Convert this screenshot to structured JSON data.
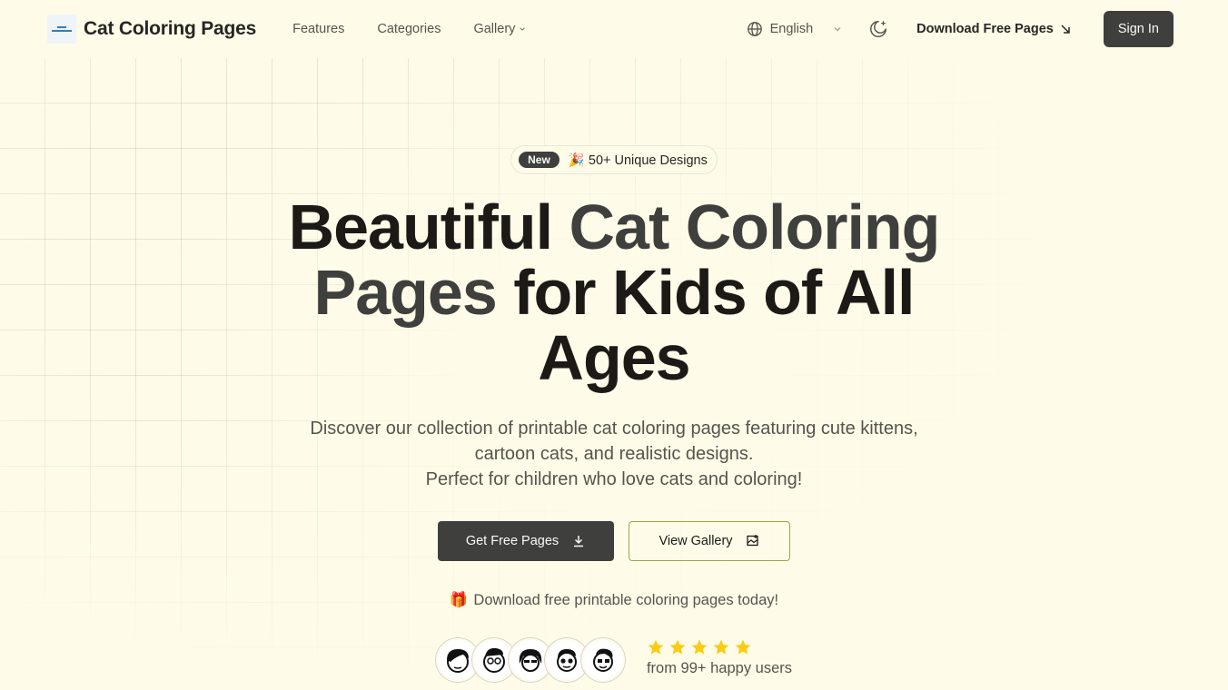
{
  "brand": {
    "name": "Cat Coloring Pages",
    "logo_icon": "brand-logo-icon"
  },
  "nav": {
    "items": [
      {
        "label": "Features"
      },
      {
        "label": "Categories"
      },
      {
        "label": "Gallery",
        "has_dropdown": true
      }
    ]
  },
  "header": {
    "language": "English",
    "download_label": "Download Free Pages",
    "signin_label": "Sign In"
  },
  "hero": {
    "badge_tag": "New",
    "badge_text": "🎉 50+ Unique Designs",
    "headline": {
      "part1": "Beautiful ",
      "accent": "Cat Coloring Pages",
      "part2": " for Kids of All Ages"
    },
    "subtitle_line1": "Discover our collection of printable cat coloring pages featuring cute kittens,",
    "subtitle_line2": "cartoon cats, and realistic designs.",
    "subtitle_line3": "Perfect for children who love cats and coloring!",
    "primary_button": "Get Free Pages",
    "secondary_button": "View Gallery",
    "promo_text": "Download free printable coloring pages today!",
    "rating_stars": 5,
    "rating_text": "from 99+ happy users"
  },
  "colors": {
    "background": "#fefce8",
    "primary": "#3f3f3e",
    "star": "#facc15",
    "text_muted": "#57534e"
  }
}
